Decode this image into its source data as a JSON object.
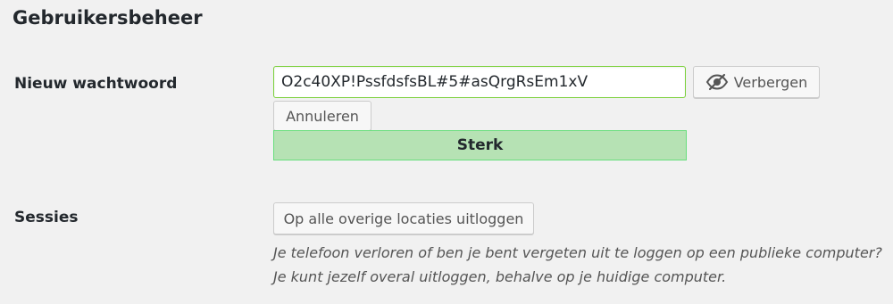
{
  "section_title": "Gebruikersbeheer",
  "password_row": {
    "label": "Nieuw wachtwoord",
    "value": "O2c40XP!PssfdsfsBL#5#asQrgRsEm1xV",
    "hide_button_label": "Verbergen",
    "hide_button_icon": "eye-slash-icon",
    "cancel_button_label": "Annuleren",
    "strength_label": "Sterk",
    "strength_color": "#b6e2b4",
    "strength_border_color": "#68de7c"
  },
  "sessions_row": {
    "label": "Sessies",
    "logout_button_label": "Op alle overige locaties uitloggen",
    "description_line1": "Je telefoon verloren of ben je bent vergeten uit te loggen op een publieke computer?",
    "description_line2": "Je kunt jezelf overal uitloggen, behalve op je huidige computer."
  }
}
